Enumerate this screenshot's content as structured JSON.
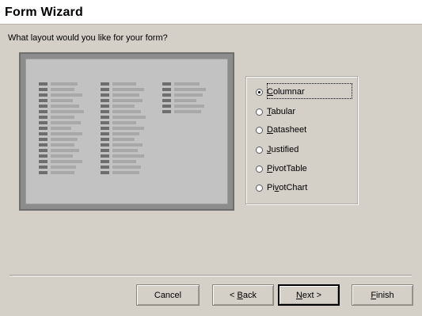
{
  "window": {
    "title": "Form Wizard"
  },
  "prompt": "What layout would you like for your form?",
  "layout_options": [
    {
      "pre": "",
      "mn": "C",
      "post": "olumnar",
      "selected": true
    },
    {
      "pre": "",
      "mn": "T",
      "post": "abular",
      "selected": false
    },
    {
      "pre": "",
      "mn": "D",
      "post": "atasheet",
      "selected": false
    },
    {
      "pre": "",
      "mn": "J",
      "post": "ustified",
      "selected": false
    },
    {
      "pre": "",
      "mn": "P",
      "post": "ivotTable",
      "selected": false
    },
    {
      "pre": "Pi",
      "mn": "v",
      "post": "otChart",
      "selected": false
    }
  ],
  "buttons": {
    "cancel": "Cancel",
    "back_pre": "< ",
    "back_mn": "B",
    "back_post": "ack",
    "next_mn": "N",
    "next_post": "ext >",
    "finish_mn": "F",
    "finish_post": "inish"
  }
}
